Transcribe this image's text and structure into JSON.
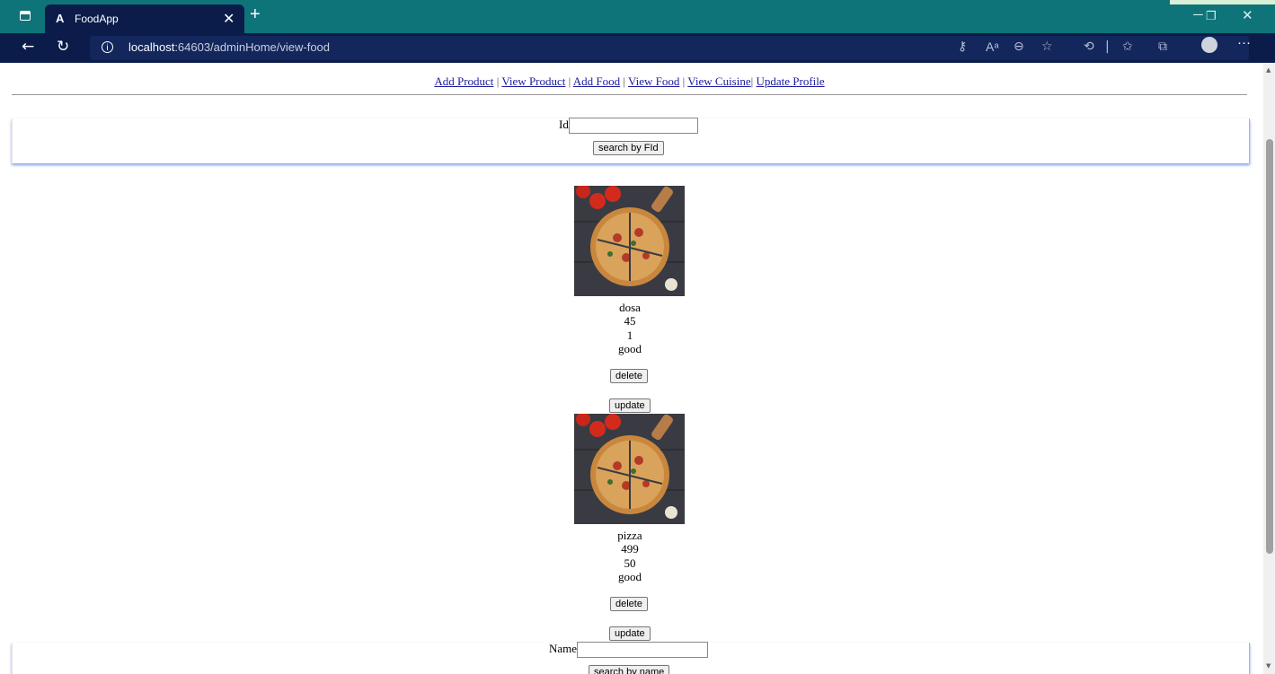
{
  "browser": {
    "tab_logo": "A",
    "tab_title": "FoodApp",
    "url_host": "localhost",
    "url_rest": ":64603/adminHome/view-food"
  },
  "nav_links": [
    "Add Product",
    "View Product",
    "Add Food",
    "View Food",
    "View Cuisine",
    "Update Profile"
  ],
  "id_search": {
    "label": "Id",
    "value": "",
    "button": "search by FId"
  },
  "foods": [
    {
      "name": "dosa",
      "price": "45",
      "quantity": "1",
      "description": "good",
      "delete_label": "delete",
      "update_label": "update"
    },
    {
      "name": "pizza",
      "price": "499",
      "quantity": "50",
      "description": "good",
      "delete_label": "delete",
      "update_label": "update"
    }
  ],
  "name_search": {
    "label": "Name",
    "value": "",
    "button": "search by name"
  }
}
